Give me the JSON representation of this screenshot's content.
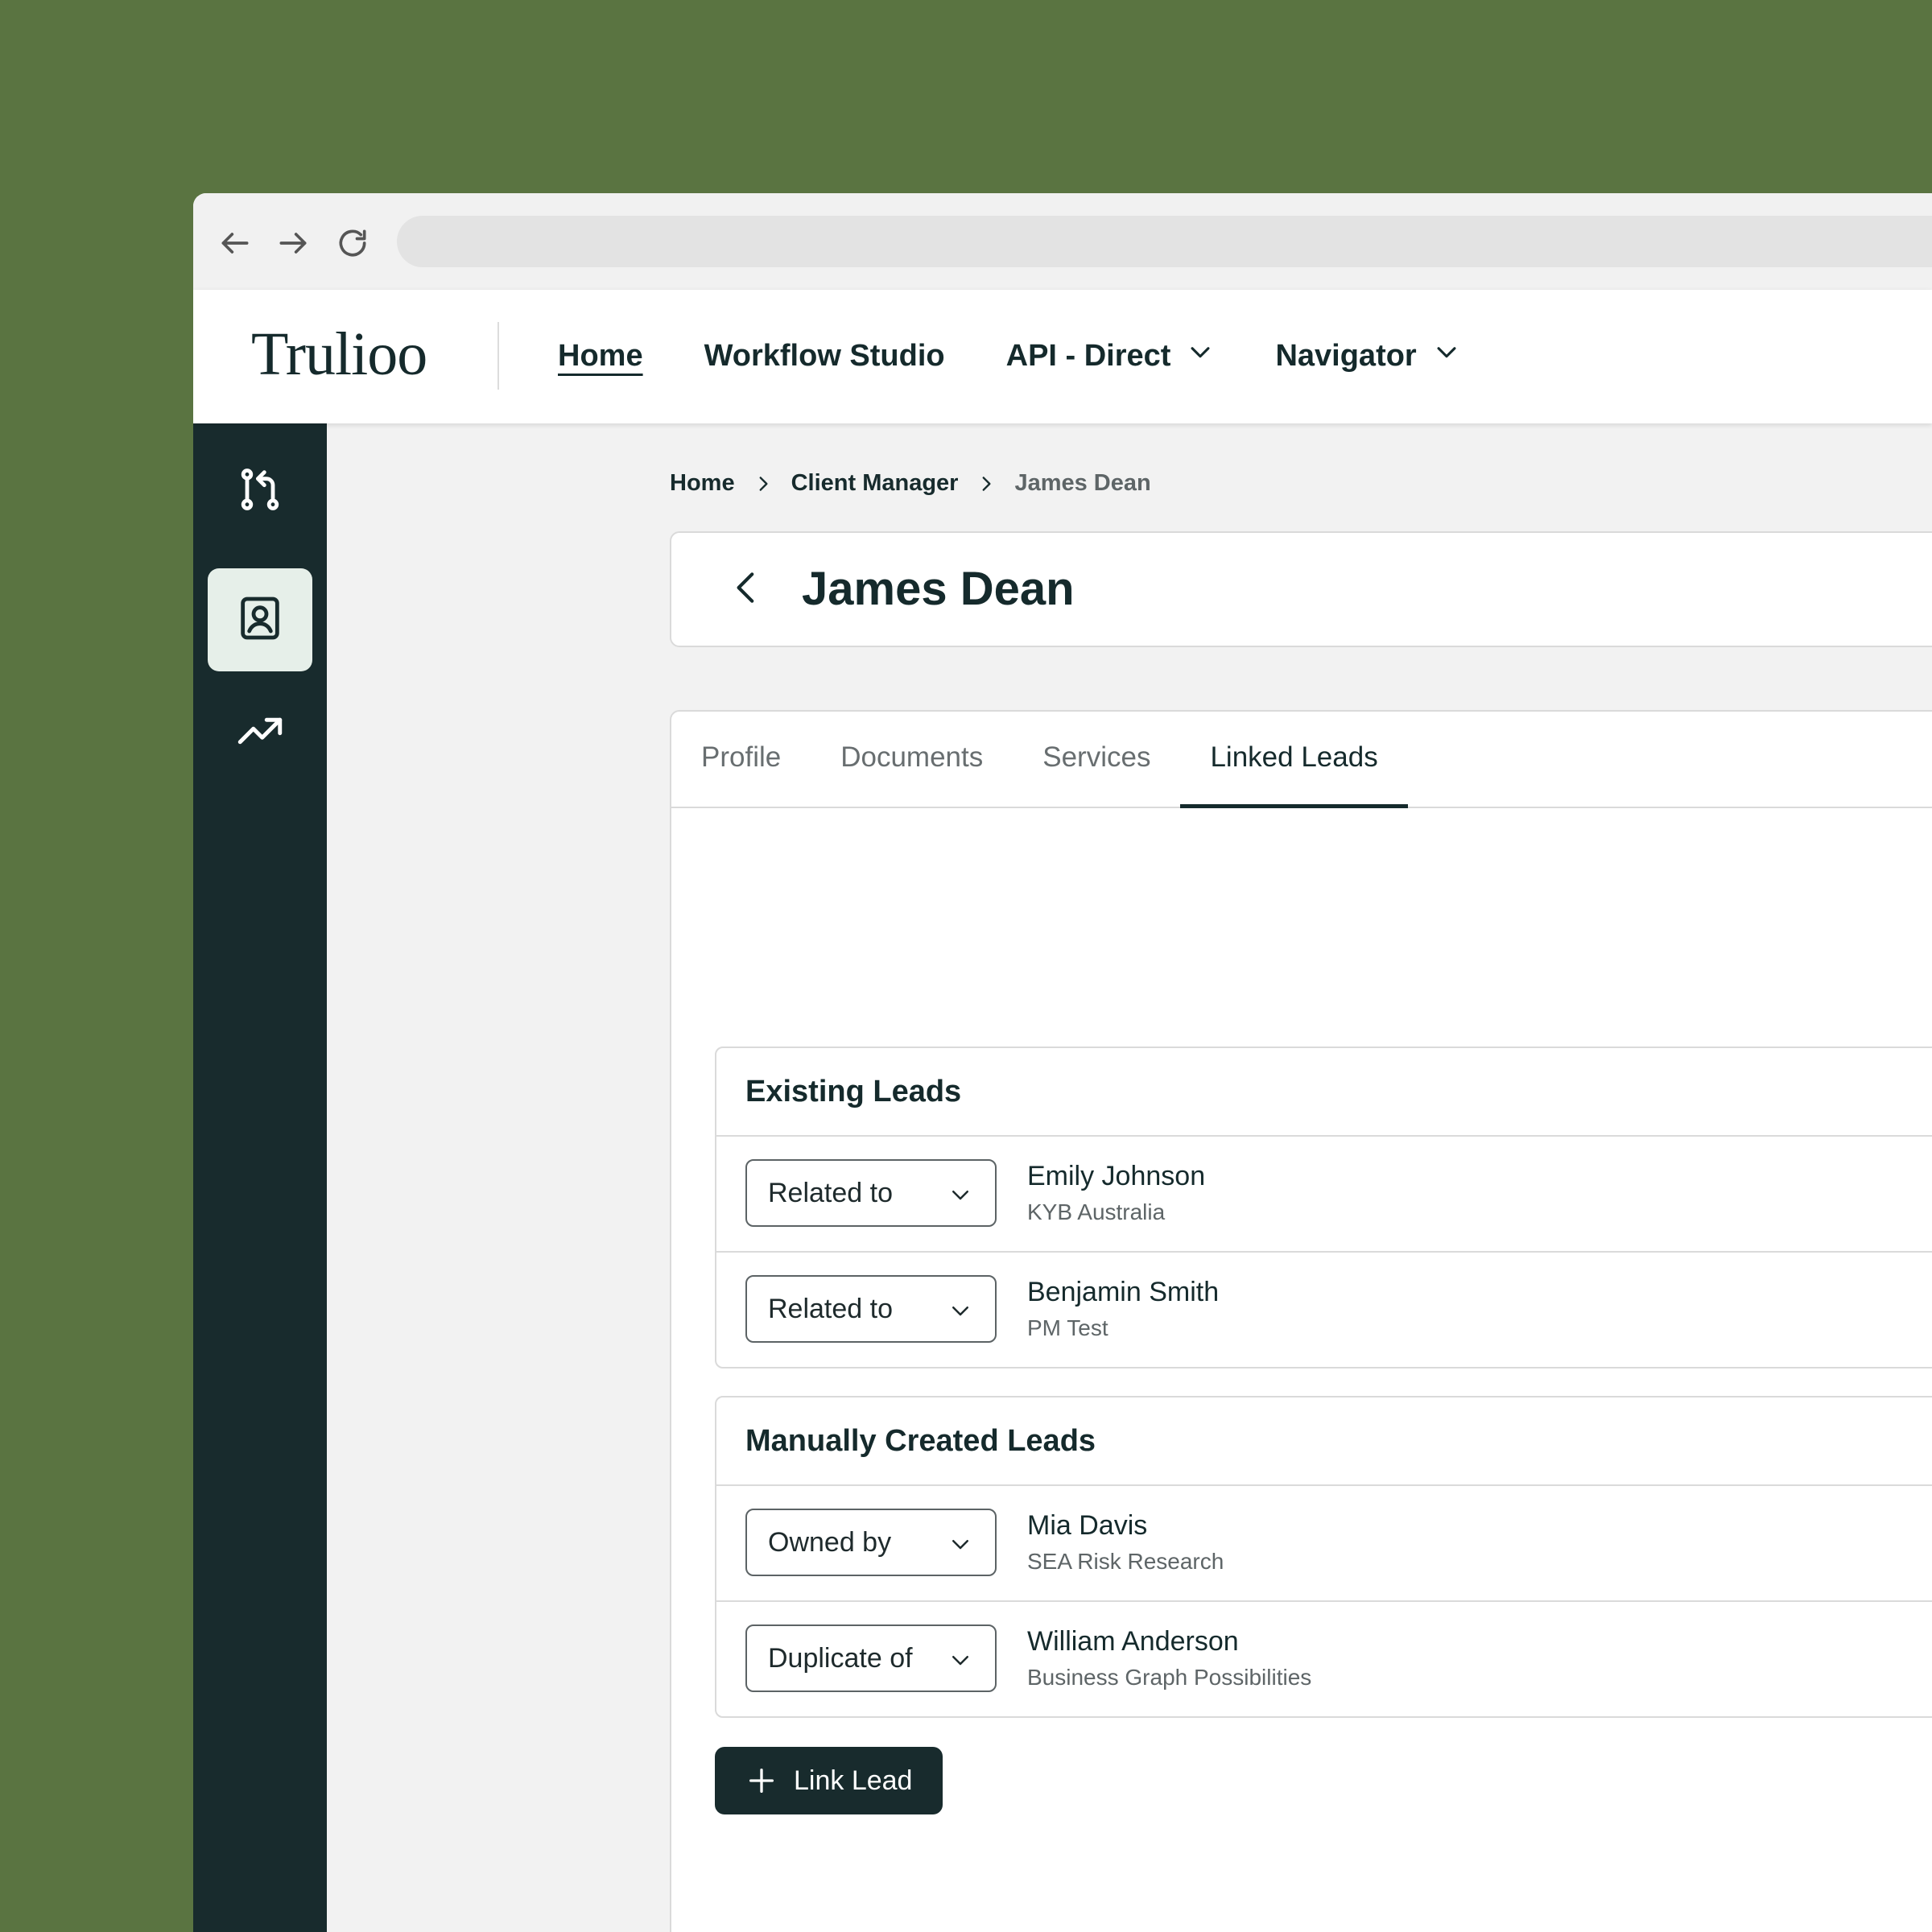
{
  "browser": {
    "back_icon": "arrow-left-icon",
    "forward_icon": "arrow-right-icon",
    "reload_icon": "reload-icon"
  },
  "header": {
    "logo": "Trulioo",
    "nav": [
      {
        "label": "Home",
        "active": true,
        "has_dropdown": false
      },
      {
        "label": "Workflow Studio",
        "active": false,
        "has_dropdown": false
      },
      {
        "label": "API - Direct",
        "active": false,
        "has_dropdown": true
      },
      {
        "label": "Navigator",
        "active": false,
        "has_dropdown": true
      }
    ]
  },
  "sidebar": {
    "items": [
      {
        "icon": "workflow-icon",
        "active": false
      },
      {
        "icon": "contact-card-icon",
        "active": true
      },
      {
        "icon": "trending-up-icon",
        "active": false
      }
    ]
  },
  "breadcrumb": [
    "Home",
    "Client Manager",
    "James Dean"
  ],
  "page": {
    "title": "James Dean"
  },
  "tabs": [
    {
      "label": "Profile",
      "active": false
    },
    {
      "label": "Documents",
      "active": false
    },
    {
      "label": "Services",
      "active": false
    },
    {
      "label": "Linked Leads",
      "active": true
    }
  ],
  "existing_leads": {
    "title": "Existing Leads",
    "rows": [
      {
        "relation": "Related to",
        "name": "Emily Johnson",
        "subtitle": "KYB Australia"
      },
      {
        "relation": "Related to",
        "name": "Benjamin Smith",
        "subtitle": "PM Test"
      }
    ]
  },
  "manual_leads": {
    "title": "Manually Created Leads",
    "rows": [
      {
        "relation": "Owned by",
        "name": "Mia Davis",
        "subtitle": "SEA Risk Research"
      },
      {
        "relation": "Duplicate of",
        "name": "William Anderson",
        "subtitle": "Business Graph Possibilities"
      }
    ]
  },
  "actions": {
    "link_lead_label": "Link Lead"
  },
  "colors": {
    "background": "#5a7441",
    "sidebar": "#182b2d",
    "primary": "#152a2c",
    "sidebar_active": "#e6efe9"
  }
}
